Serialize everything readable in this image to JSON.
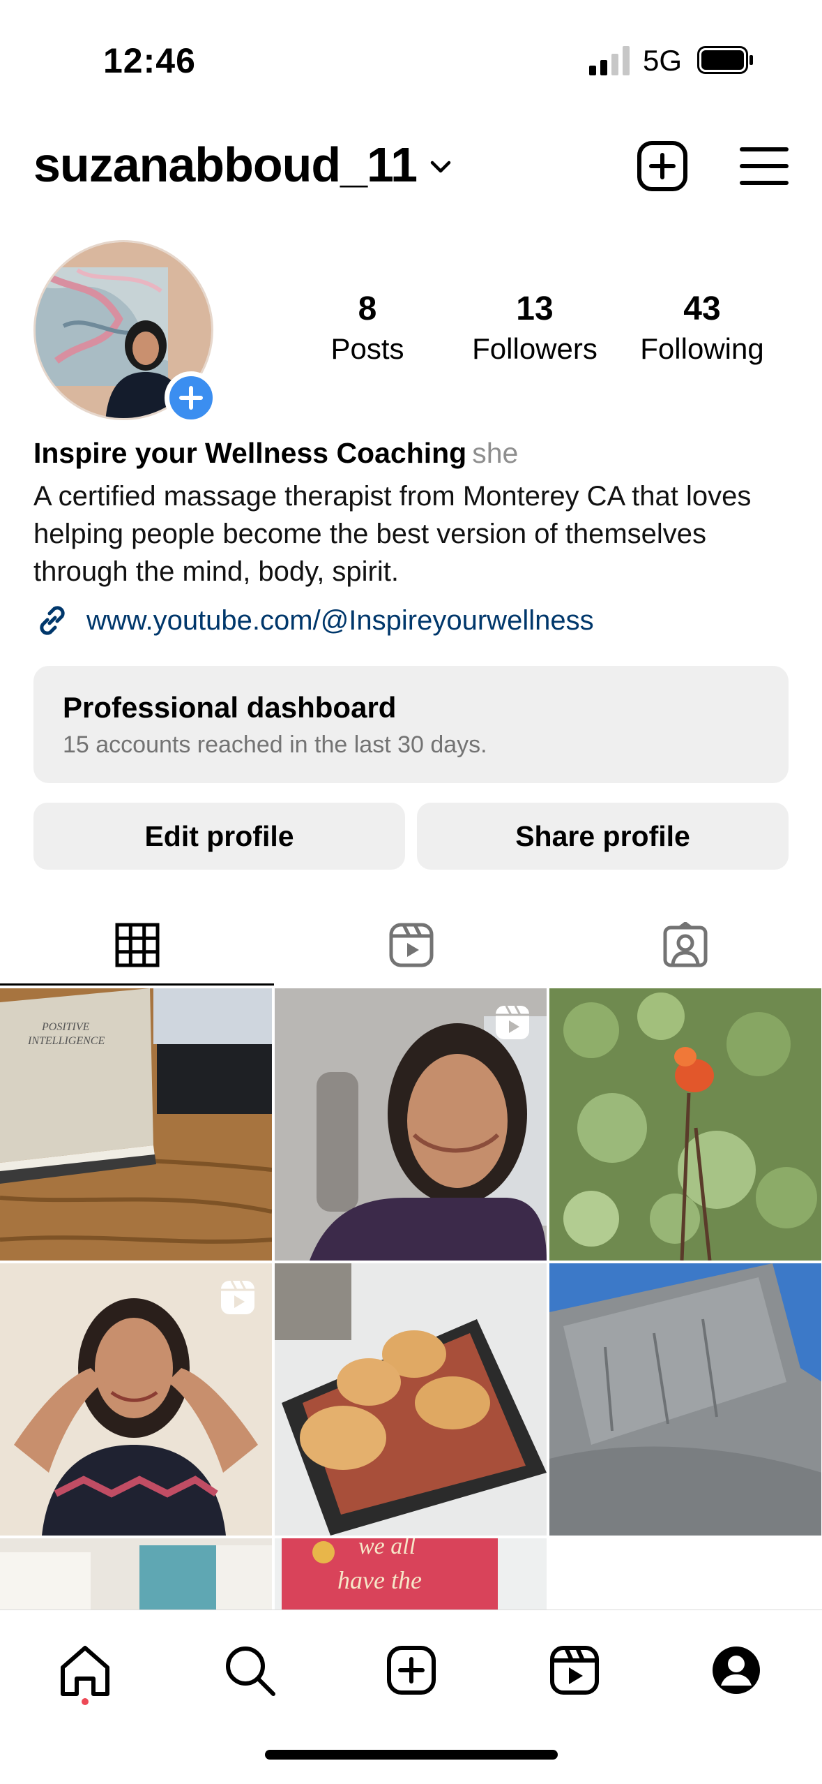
{
  "status_bar": {
    "time": "12:46",
    "network": "5G"
  },
  "header": {
    "username": "suzanabboud_11"
  },
  "profile": {
    "stats": [
      {
        "value": "8",
        "label": "Posts"
      },
      {
        "value": "13",
        "label": "Followers"
      },
      {
        "value": "43",
        "label": "Following"
      }
    ],
    "name": "Inspire your Wellness Coaching",
    "pronoun": "she",
    "bio": "A certified massage therapist from Monterey CA that loves helping people become the best version of themselves through the mind, body, spirit.",
    "link": "www.youtube.com/@Inspireyourwellness"
  },
  "dashboard": {
    "title": "Professional dashboard",
    "subtitle": "15 accounts reached in the last 30 days."
  },
  "buttons": {
    "edit": "Edit profile",
    "share": "Share profile"
  },
  "tabs": [
    "grid-icon",
    "reels-icon",
    "tagged-icon"
  ],
  "grid_posts": [
    {
      "type": "photo",
      "subject": "book-on-desk"
    },
    {
      "type": "reel",
      "subject": "selfie-in-car"
    },
    {
      "type": "photo",
      "subject": "orange-flower"
    },
    {
      "type": "reel",
      "subject": "woman-stretching"
    },
    {
      "type": "photo",
      "subject": "bread-rolls"
    },
    {
      "type": "photo",
      "subject": "granite-rock"
    },
    {
      "type": "photo",
      "subject": "window"
    },
    {
      "type": "photo",
      "subject": "sign-we-all-have-the-power"
    }
  ],
  "sign_text": {
    "line1": "we all",
    "line2": "have the"
  },
  "book_text": {
    "line1": "POSITIVE",
    "line2": "INTELLIGENCE"
  },
  "bottom_nav": [
    "home-icon",
    "search-icon",
    "create-icon",
    "reels-icon",
    "profile-icon"
  ],
  "colors": {
    "link": "#00376b",
    "accent": "#3b8ef0",
    "notify": "#ed4956",
    "button_bg": "#efefef"
  }
}
